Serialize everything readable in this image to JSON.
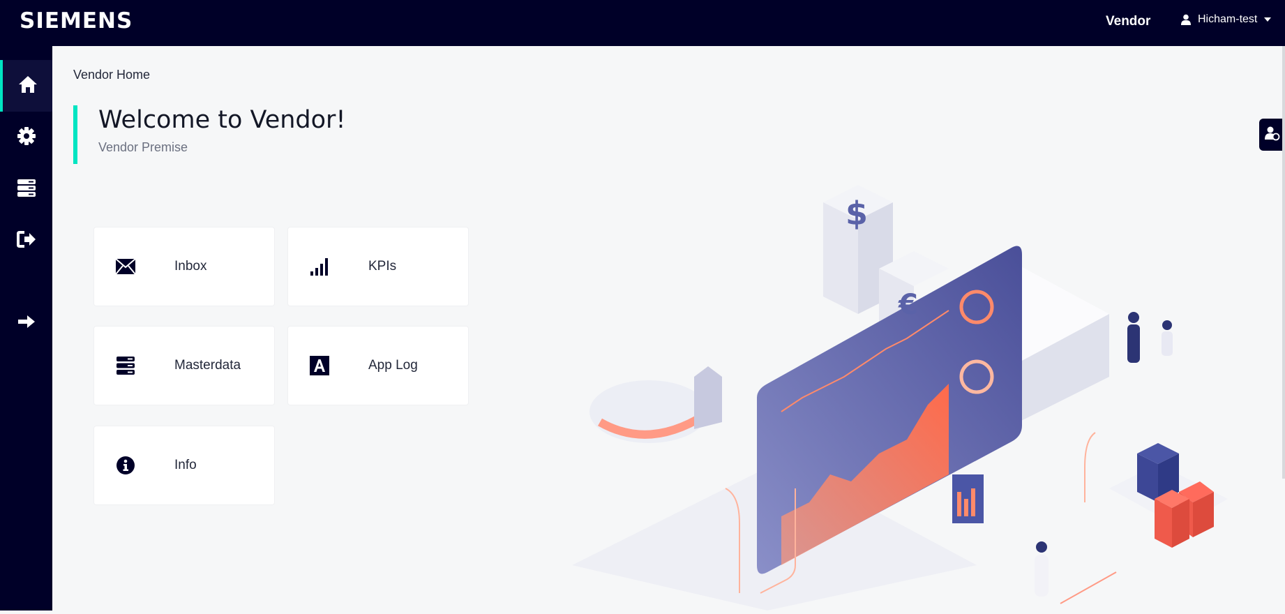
{
  "header": {
    "logo": "SIEMENS",
    "app_name": "Vendor",
    "user_name": "Hicham-test"
  },
  "sidebar": {
    "items": [
      {
        "name": "home",
        "icon": "home-icon",
        "active": true
      },
      {
        "name": "settings",
        "icon": "gear-icon",
        "active": false
      },
      {
        "name": "masterdata",
        "icon": "server-icon",
        "active": false
      },
      {
        "name": "logout",
        "icon": "sign-out-icon",
        "active": false
      },
      {
        "name": "expand",
        "icon": "arrow-right-icon",
        "active": false
      }
    ]
  },
  "breadcrumb": "Vendor Home",
  "hero": {
    "title": "Welcome to Vendor!",
    "subtitle": "Vendor Premise"
  },
  "tiles": [
    {
      "label": "Inbox",
      "icon": "envelope-icon"
    },
    {
      "label": "KPIs",
      "icon": "signal-bars-icon"
    },
    {
      "label": "Masterdata",
      "icon": "server-icon"
    },
    {
      "label": "App Log",
      "icon": "font-icon"
    },
    {
      "label": "Info",
      "icon": "info-circle-icon"
    }
  ],
  "colors": {
    "navy": "#000028",
    "accent": "#00e5c2",
    "background": "#f6f7f8"
  }
}
